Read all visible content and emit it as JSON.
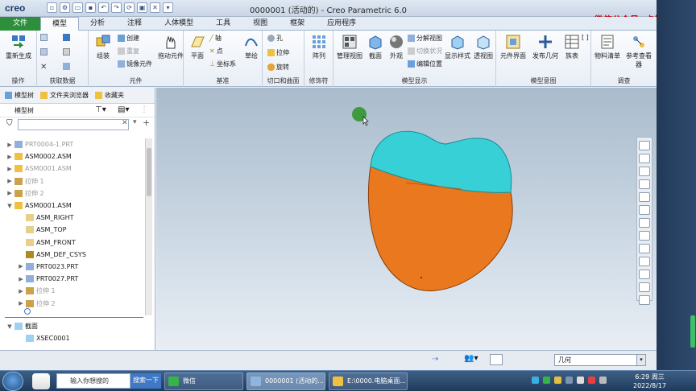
{
  "app": {
    "logo": "creo",
    "title": "0000001 (活动的) - Creo Parametric 6.0",
    "watermark": "微信公众号:  卡拉拉"
  },
  "tabs": [
    {
      "label": "文件"
    },
    {
      "label": "模型"
    },
    {
      "label": "分析"
    },
    {
      "label": "注释"
    },
    {
      "label": "人体模型"
    },
    {
      "label": "工具"
    },
    {
      "label": "视图"
    },
    {
      "label": "框架"
    },
    {
      "label": "应用程序"
    }
  ],
  "ribbon": {
    "operations": {
      "name": "操作",
      "regenerate": "重新生成"
    },
    "get_data": {
      "name": "获取数据"
    },
    "component": {
      "name": "元件",
      "assemble": "组装",
      "create": "创建",
      "repeat": "重复",
      "mirror": "镜像元件",
      "drag": "拖动元件"
    },
    "datum": {
      "name": "基准",
      "plane": "平面",
      "axis": "轴",
      "point": "点",
      "csys": "坐标系",
      "sketch": "草绘"
    },
    "cut_surface": {
      "name": "切口和曲面",
      "hole": "孔",
      "extrude": "拉伸",
      "revolve": "旋转"
    },
    "modifiers": {
      "name": "修饰符",
      "pattern": "阵列"
    },
    "model_display": {
      "name": "模型显示",
      "manage_views": "管理视图",
      "section": "截面",
      "appearance": "外观",
      "explode": "分解视图",
      "toggle_state": "切换状况",
      "edit_position": "编辑位置",
      "display_style": "显示样式",
      "perspective": "透视图"
    },
    "model_intent": {
      "name": "模型意图",
      "component_interface": "元件界面",
      "publish_geometry": "发布几何",
      "family_table": "族表"
    },
    "investigate": {
      "name": "调查",
      "bom": "物料清单",
      "reference_viewer": "参考查看器"
    }
  },
  "left_panel": {
    "tabs": [
      "模型树",
      "文件夹浏览器",
      "收藏夹"
    ],
    "header": "模型树",
    "tree": [
      {
        "label": "PRT0004-1.PRT",
        "dim": true,
        "indent": 0,
        "icon": "part",
        "exp": "▶"
      },
      {
        "label": "ASM0002.ASM",
        "dim": false,
        "indent": 0,
        "icon": "asm",
        "exp": "▶"
      },
      {
        "label": "ASM0001.ASM",
        "dim": true,
        "indent": 0,
        "icon": "asm",
        "exp": "▶"
      },
      {
        "label": "拉伸 1",
        "dim": true,
        "indent": 0,
        "icon": "feat",
        "exp": "▶"
      },
      {
        "label": "拉伸 2",
        "dim": true,
        "indent": 0,
        "icon": "feat",
        "exp": "▶"
      },
      {
        "label": "ASM0001.ASM",
        "dim": false,
        "indent": 0,
        "icon": "asm",
        "exp": "▼"
      },
      {
        "label": "ASM_RIGHT",
        "dim": false,
        "indent": 1,
        "icon": "plane",
        "exp": ""
      },
      {
        "label": "ASM_TOP",
        "dim": false,
        "indent": 1,
        "icon": "plane",
        "exp": ""
      },
      {
        "label": "ASM_FRONT",
        "dim": false,
        "indent": 1,
        "icon": "plane",
        "exp": ""
      },
      {
        "label": "ASM_DEF_CSYS",
        "dim": false,
        "indent": 1,
        "icon": "csys",
        "exp": ""
      },
      {
        "label": "PRT0023.PRT",
        "dim": false,
        "indent": 1,
        "icon": "part",
        "exp": "▶"
      },
      {
        "label": "PRT0027.PRT",
        "dim": false,
        "indent": 1,
        "icon": "part",
        "exp": "▶"
      },
      {
        "label": "拉伸 1",
        "dim": true,
        "indent": 1,
        "icon": "feat",
        "exp": "▶"
      },
      {
        "label": "拉伸 2",
        "dim": true,
        "indent": 1,
        "icon": "feat",
        "exp": "▶"
      }
    ],
    "section_tree": [
      {
        "label": "截面",
        "indent": 0,
        "exp": "▼"
      },
      {
        "label": "XSEC0001",
        "indent": 1,
        "exp": ""
      }
    ]
  },
  "status": {
    "filter_select": "几何"
  },
  "taskbar": {
    "search_placeholder": "输入你想搜的",
    "search_button": "搜索一下",
    "items": [
      "微信",
      "0000001 (活动的...",
      "E:\\0000.电脑桌面..."
    ],
    "time": "6:29 周三",
    "date": "2022/8/17"
  },
  "colors": {
    "model_top": "#35d0d4",
    "model_body": "#e9781e",
    "file_tab": "#2d8f3c",
    "viewport_top": "#a9bbcc",
    "watermark": "#e00000"
  }
}
